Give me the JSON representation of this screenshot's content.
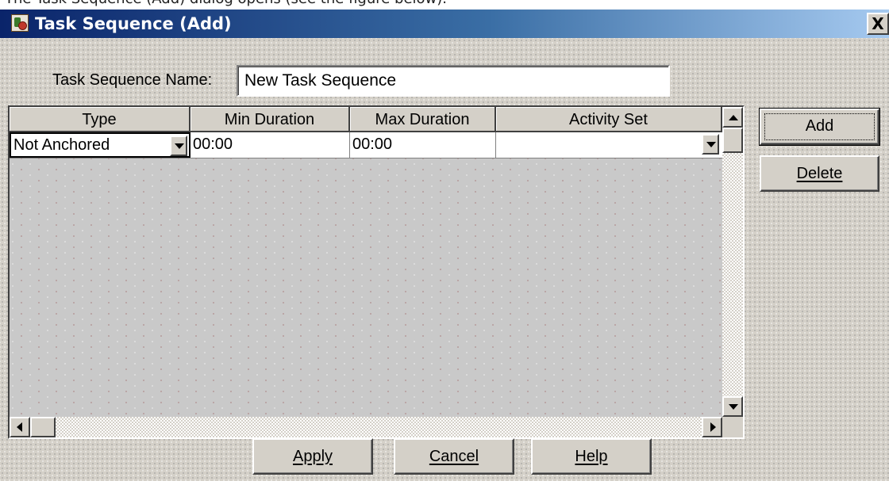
{
  "page_caption": "The Task Sequence (Add) dialog opens (see the figure below).",
  "dialog": {
    "title": "Task Sequence (Add)",
    "close_glyph": "X"
  },
  "form": {
    "name_label": "Task Sequence Name:",
    "name_value": "New Task Sequence"
  },
  "grid": {
    "columns": [
      "Type",
      "Min Duration",
      "Max Duration",
      "Activity Set"
    ],
    "rows": [
      {
        "type": "Not Anchored",
        "min_duration": "00:00",
        "max_duration": "00:00",
        "activity_set": ""
      }
    ]
  },
  "side_buttons": {
    "add": "Add",
    "delete": "Delete"
  },
  "bottom_buttons": {
    "apply": "Apply",
    "cancel": "Cancel",
    "help": "Help"
  },
  "colors": {
    "dialog_face": "#d4d0c8",
    "titlebar_start": "#0a246a",
    "titlebar_end": "#a6caf0"
  }
}
